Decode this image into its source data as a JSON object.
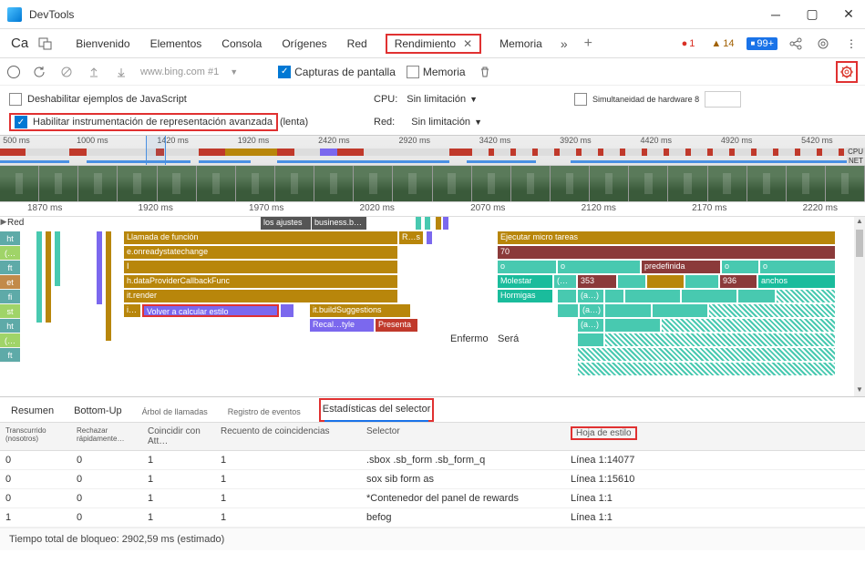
{
  "window": {
    "title": "DevTools"
  },
  "tabbar": {
    "ca": "Ca",
    "tabs": [
      "Bienvenido",
      "Elementos",
      "Consola",
      "Orígenes",
      "Red"
    ],
    "active_tab": "Rendimiento",
    "after_active": [
      "Memoria"
    ],
    "badges": {
      "err_dot": "●",
      "err": "1",
      "warn_tri": "▲",
      "warn": "14",
      "msg_icon": "■",
      "msg": "99+"
    }
  },
  "toolbar": {
    "url": "www.bing.com #1",
    "screenshots_label": "Capturas de pantalla",
    "memory_label": "Memoria"
  },
  "settings": {
    "disable_js": "Deshabilitar ejemplos de JavaScript",
    "cpu_label": "CPU:",
    "cpu_value": "Sin limitación",
    "hw_label": "Simultaneidad de hardware 8",
    "advanced_rendering": "Habilitar instrumentación de representación avanzada",
    "advanced_suffix": "(lenta)",
    "net_label": "Red:",
    "net_value": "Sin limitación"
  },
  "overview_ticks": [
    "500 ms",
    "1000 ms",
    "1420 ms",
    "1920 ms",
    "2420 ms",
    "2920 ms",
    "3420 ms",
    "3920 ms",
    "4420 ms",
    "4920 ms",
    "5420 ms"
  ],
  "overview_labels": {
    "cpu": "CPU",
    "net": "NET"
  },
  "ruler_ticks": [
    "1870 ms",
    "1920 ms",
    "1970 ms",
    "2020 ms",
    "2070 ms",
    "2120 ms",
    "2170 ms",
    "2220 ms"
  ],
  "tracks": {
    "red": "Red"
  },
  "track_labels": [
    "ht",
    "(…",
    "ft",
    "et",
    "fi",
    "st",
    "ht",
    "(…",
    "ft"
  ],
  "flame": {
    "settings_chip": "los ajustes",
    "business": "business.b…",
    "func_call": "Llamada de función",
    "rs": "R…s",
    "micro": "Ejecutar micro tareas",
    "onready": "e.onreadystatechange",
    "seventy": "70",
    "i": "I",
    "o": "o",
    "pred": "predefinida",
    "hdata": "h.dataProviderCallbackFunc",
    "molest": "Molestar",
    "ellips": "(…",
    "n353": "353",
    "n936": "936",
    "anchos": "anchos",
    "itrender": "it.render",
    "horm": "Hormigas",
    "a": "(a…)",
    "volver": "Volver a calcular estilo",
    "itbuild": "it.buildSuggestions",
    "recal": "Recal…tyle",
    "present": "Presenta",
    "enfermo": "Enfermo",
    "sera": "Será"
  },
  "result_tabs": {
    "resumen": "Resumen",
    "bottom": "Bottom-Up",
    "arbol": "Árbol de llamadas",
    "registro": "Registro de eventos",
    "selector": "Estadísticas del selector"
  },
  "table": {
    "headers": [
      "Transcurrido (nosotros)",
      "Rechazar rápidamente…",
      "Coincidir con Att…",
      "Recuento de coincidencias",
      "Selector",
      "Hoja de estilo"
    ],
    "rows": [
      [
        "0",
        "0",
        "1",
        "1",
        ".sbox .sb_form .sb_form_q",
        "Línea 1:14077"
      ],
      [
        "0",
        "0",
        "1",
        "1",
        "sox sib form as",
        "Línea 1:15610"
      ],
      [
        "0",
        "0",
        "1",
        "1",
        "*Contenedor del panel de rewards",
        "Línea 1:1"
      ],
      [
        "1",
        "0",
        "1",
        "1",
        "befog",
        "Línea 1:1"
      ]
    ]
  },
  "footer": "Tiempo total de bloqueo: 2902,59 ms (estimado)"
}
